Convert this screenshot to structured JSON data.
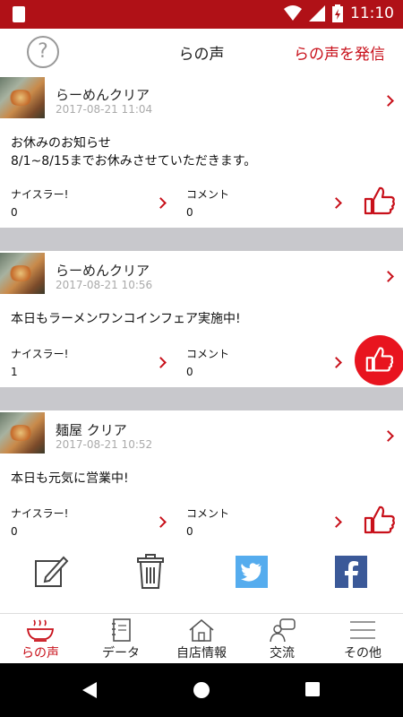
{
  "status": {
    "time": "11:10"
  },
  "header": {
    "title": "らの声",
    "post_label": "らの声を発信"
  },
  "posts": [
    {
      "shop": "らーめんクリア",
      "time": "2017-08-21 11:04",
      "body_line1": "お休みのお知らせ",
      "body_line2": "8/1~8/15までお休みさせていただきます。",
      "nice_label": "ナイスラー!",
      "nice_count": "0",
      "comment_label": "コメント",
      "comment_count": "0",
      "liked": false
    },
    {
      "shop": "らーめんクリア",
      "time": "2017-08-21 10:56",
      "body_line1": "本日もラーメンワンコインフェア実施中!",
      "body_line2": "",
      "nice_label": "ナイスラー!",
      "nice_count": "1",
      "comment_label": "コメント",
      "comment_count": "0",
      "liked": true
    },
    {
      "shop": "麺屋 クリア",
      "time": "2017-08-21 10:52",
      "body_line1": "本日も元気に営業中!",
      "body_line2": "",
      "nice_label": "ナイスラー!",
      "nice_count": "0",
      "comment_label": "コメント",
      "comment_count": "0",
      "liked": false
    }
  ],
  "tabs": [
    {
      "label": "らの声",
      "icon": "ramen-bowl-icon",
      "active": true
    },
    {
      "label": "データ",
      "icon": "notebook-icon",
      "active": false
    },
    {
      "label": "自店情報",
      "icon": "house-icon",
      "active": false
    },
    {
      "label": "交流",
      "icon": "chat-user-icon",
      "active": false
    },
    {
      "label": "その他",
      "icon": "menu-icon",
      "active": false
    }
  ],
  "colors": {
    "accent": "#c8101a",
    "status_bar": "#b01117",
    "like_fab": "#e8141f",
    "twitter": "#55acee",
    "facebook": "#3b5998"
  }
}
